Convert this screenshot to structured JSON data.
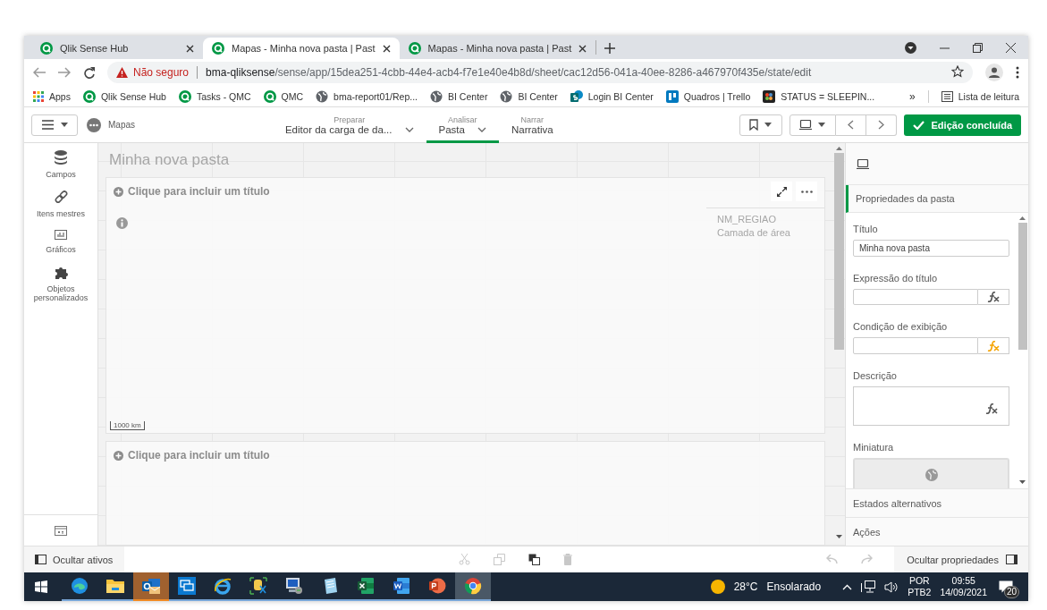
{
  "browser": {
    "tabs": [
      {
        "title": "Qlik Sense Hub",
        "selected": false
      },
      {
        "title": "Mapas - Minha nova pasta | Past",
        "selected": true
      },
      {
        "title": "Mapas - Minha nova pasta | Past",
        "selected": false
      }
    ],
    "address": {
      "security": "Não seguro",
      "host": "bma-qliksense",
      "path": "/sense/app/15dea251-4cbb-44e4-acb4-f7e1e40e4b8d/sheet/cac12d56-041a-40ee-8286-a467970f435e/state/edit"
    },
    "bookmarks": [
      {
        "label": "Apps",
        "kind": "apps"
      },
      {
        "label": "Qlik Sense Hub",
        "kind": "qlik"
      },
      {
        "label": "Tasks - QMC",
        "kind": "qlik"
      },
      {
        "label": "QMC",
        "kind": "qlik"
      },
      {
        "label": "bma-report01/Rep...",
        "kind": "globe"
      },
      {
        "label": "BI Center",
        "kind": "globe"
      },
      {
        "label": "BI Center",
        "kind": "globe"
      },
      {
        "label": "Login BI Center",
        "kind": "sharepoint"
      },
      {
        "label": "Quadros | Trello",
        "kind": "board"
      },
      {
        "label": "STATUS = SLEEPIN...",
        "kind": "dark"
      }
    ],
    "overflow": "»",
    "reading_list": "Lista de leitura"
  },
  "toolbar": {
    "app_name": "Mapas",
    "nav": [
      {
        "caption": "Preparar",
        "label": "Editor da carga de da...",
        "dropdown": true,
        "selected": false
      },
      {
        "caption": "Analisar",
        "label": "Pasta",
        "dropdown": true,
        "selected": true
      },
      {
        "caption": "Narrar",
        "label": "Narrativa",
        "dropdown": false,
        "selected": false
      }
    ],
    "done_button": "Edição concluída"
  },
  "assets": [
    {
      "label": "Campos",
      "kind": "fields"
    },
    {
      "label": "Itens mestres",
      "kind": "master"
    },
    {
      "label": "Gráficos",
      "kind": "charts"
    },
    {
      "label": "Objetos personalizados",
      "kind": "custom"
    }
  ],
  "sheet": {
    "title": "Minha nova pasta",
    "cards": [
      {
        "kind": "map",
        "title": "Clique para incluir um título",
        "legend_title": "NM_REGIAO",
        "legend_subtitle": "Camada de área",
        "scale": "1000 km"
      },
      {
        "kind": "empty",
        "title": "Clique para incluir um título"
      }
    ]
  },
  "properties": {
    "section": "Propriedades da pasta",
    "fields": [
      {
        "kind": "text",
        "label": "Título",
        "value": "Minha nova pasta"
      },
      {
        "kind": "expression",
        "label": "Expressão do título",
        "conditional": false
      },
      {
        "kind": "expression",
        "label": "Condição de exibição",
        "conditional": true
      },
      {
        "kind": "textarea",
        "label": "Descrição"
      },
      {
        "kind": "thumbnail",
        "label": "Miniatura"
      }
    ],
    "sections": [
      "Estados alternativos",
      "Ações"
    ]
  },
  "bottom_bar": {
    "hide_assets": "Ocultar ativos",
    "hide_properties": "Ocultar propriedades"
  },
  "taskbar": {
    "apps": [
      {
        "kind": "edge",
        "attention": false,
        "focused": false
      },
      {
        "kind": "explorer",
        "attention": false,
        "focused": false
      },
      {
        "kind": "outlook",
        "attention": true,
        "focused": false
      },
      {
        "kind": "remote",
        "attention": false,
        "focused": false
      },
      {
        "kind": "ie",
        "attention": false,
        "focused": false
      },
      {
        "kind": "database",
        "attention": false,
        "focused": false
      },
      {
        "kind": "computer",
        "attention": false,
        "focused": false
      },
      {
        "kind": "notepad",
        "attention": false,
        "focused": false
      },
      {
        "kind": "excel",
        "attention": false,
        "focused": false
      },
      {
        "kind": "word",
        "attention": false,
        "focused": false
      },
      {
        "kind": "powerpoint",
        "attention": false,
        "focused": false
      },
      {
        "kind": "chrome",
        "attention": false,
        "focused": true
      }
    ],
    "temperature": "28°C",
    "weather": "Ensolarado",
    "language": "POR",
    "layout": "PTB2",
    "time": "09:55",
    "date": "14/09/2021",
    "notifications": "20"
  }
}
